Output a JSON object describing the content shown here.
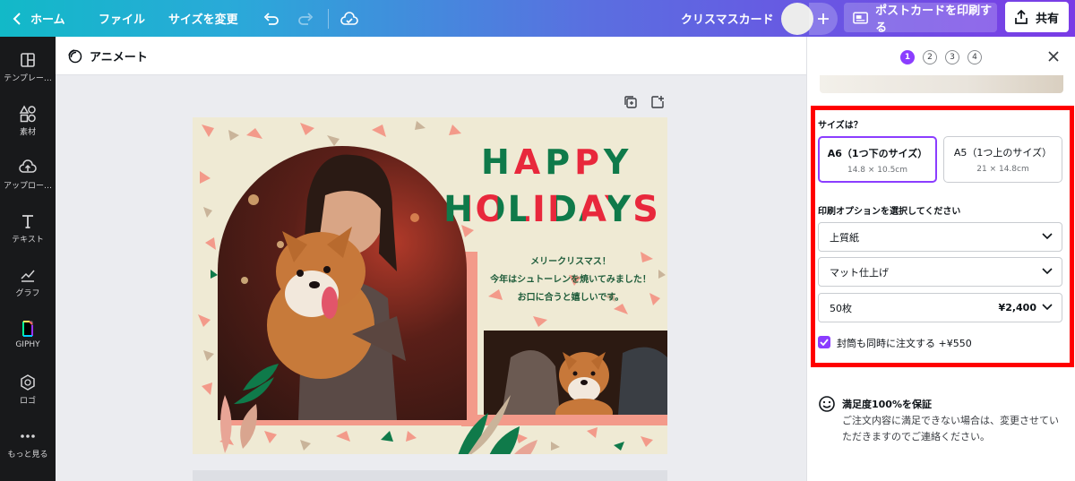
{
  "topbar": {
    "home": "ホーム",
    "file": "ファイル",
    "resize": "サイズを変更",
    "doc_title": "クリスマスカード",
    "print_button": "ポストカードを印刷する",
    "share_button": "共有"
  },
  "sidebar": {
    "items": [
      {
        "label": "テンプレー…",
        "icon": "template-icon"
      },
      {
        "label": "素材",
        "icon": "elements-icon"
      },
      {
        "label": "アップロー…",
        "icon": "upload-icon"
      },
      {
        "label": "テキスト",
        "icon": "text-icon"
      },
      {
        "label": "グラフ",
        "icon": "chart-icon"
      },
      {
        "label": "GIPHY",
        "icon": "giphy-icon"
      },
      {
        "label": "ロゴ",
        "icon": "logo-icon"
      },
      {
        "label": "もっと見る",
        "icon": "more-icon"
      }
    ]
  },
  "editor": {
    "animate_label": "アニメート"
  },
  "card": {
    "happy": "HAPPY",
    "holidays": "HOLIDAYS",
    "greeting": [
      "メリークリスマス！",
      "今年はシュトーレンを焼いてみました！",
      "お口に合うと嬉しいです。"
    ],
    "colors": {
      "green": "#0f7a4a",
      "red": "#e8283c",
      "tan": "#c9b49a",
      "pink": "#f39a8a"
    }
  },
  "panel": {
    "steps": [
      "1",
      "2",
      "3",
      "4"
    ],
    "active_step": 1,
    "size_question": "サイズは？",
    "sizes": [
      {
        "name": "A6（1つ下のサイズ）",
        "dims": "14.8 × 10.5cm",
        "selected": true
      },
      {
        "name": "A5（1つ上のサイズ）",
        "dims": "21 × 14.8cm",
        "selected": false
      }
    ],
    "print_options_title": "印刷オプションを選択してください",
    "paper": "上質紙",
    "finish": "マット仕上げ",
    "quantity": "50枚",
    "price": "¥2,400",
    "envelope_label": "封筒も同時に注文する +¥550",
    "envelope_checked": true,
    "guarantee_title": "満足度100%を保証",
    "guarantee_body": "ご注文内容に満足できない場合は、変更させていただきますのでご連絡ください。",
    "accent_color": "#8b3dff"
  }
}
